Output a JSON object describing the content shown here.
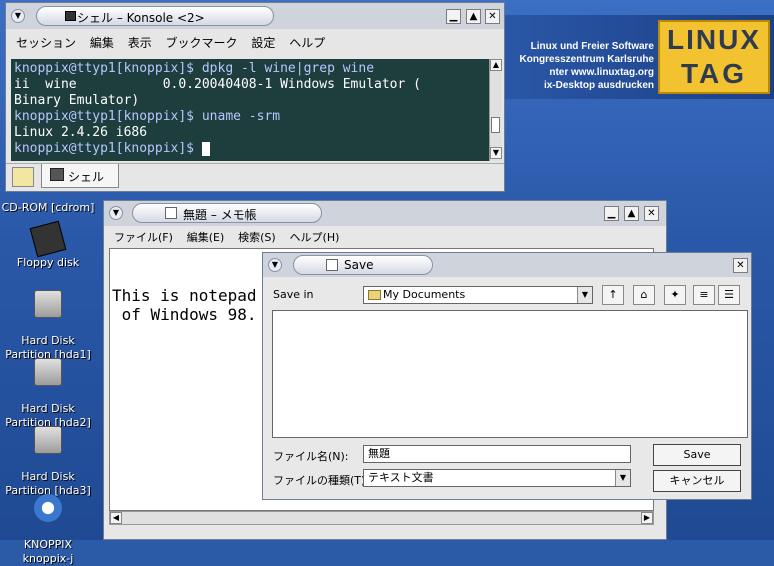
{
  "wallpaper": {
    "banner_lines": [
      "Linux und Freier Software",
      "Kongresszentrum Karlsruhe",
      "nter www.linuxtag.org",
      "ix-Desktop ausdrucken"
    ],
    "logo_line1": "LINUX",
    "logo_line2": "TAG"
  },
  "desktop_icons": [
    {
      "label": "CD-ROM [cdrom]",
      "icon": "cdrom-icon"
    },
    {
      "label": "Floppy disk",
      "icon": "floppy-icon"
    },
    {
      "label": "Hard Disk\nPartition [hda1]",
      "icon": "hard-disk-icon"
    },
    {
      "label": "Hard Disk\nPartition [hda2]",
      "icon": "hard-disk-icon"
    },
    {
      "label": "Hard Disk\nPartition [hda3]",
      "icon": "hard-disk-icon"
    },
    {
      "label": "KNOPPIX\nknoppix-j",
      "icon": "knoppix-icon"
    }
  ],
  "konsole": {
    "title": "シェル – Konsole <2>",
    "menu": [
      "セッション",
      "編集",
      "表示",
      "ブックマーク",
      "設定",
      "ヘルプ"
    ],
    "lines": [
      "knoppix@ttyp1[knoppix]$ dpkg -l wine|grep wine",
      "ii  wine           0.0.20040408-1 Windows Emulator (",
      "Binary Emulator)",
      "knoppix@ttyp1[knoppix]$ uname -srm",
      "Linux 2.4.26 i686",
      "knoppix@ttyp1[knoppix]$ "
    ],
    "tab_label": "シェル"
  },
  "notepad": {
    "title": "無題 – メモ帳",
    "menu": [
      "ファイル(F)",
      "編集(E)",
      "検索(S)",
      "ヘルプ(H)"
    ],
    "text": "This is notepad\n of Windows 98."
  },
  "save_dialog": {
    "title": "Save",
    "save_in_label": "Save in",
    "save_in_value": "My Documents",
    "filename_label": "ファイル名(N):",
    "filename_value": "無題",
    "filetype_label": "ファイルの種類(T):",
    "filetype_value": "テキスト文書",
    "save_button": "Save",
    "cancel_button": "キャンセル"
  }
}
